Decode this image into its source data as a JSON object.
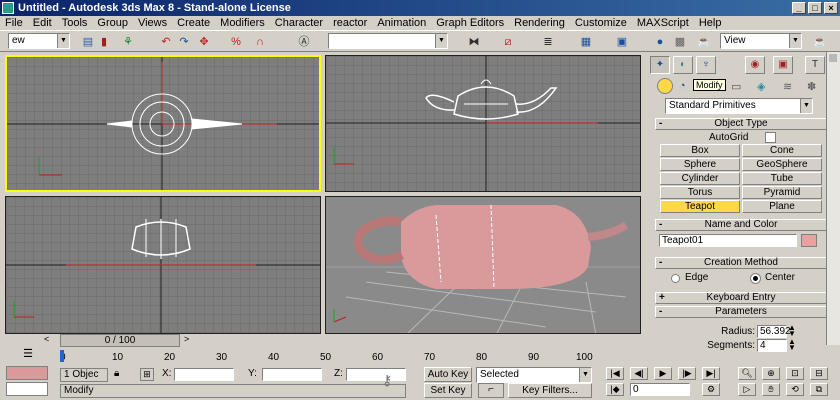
{
  "window": {
    "title": "Untitled  - Autodesk 3ds Max 8  - Stand-alone License",
    "minimize": "_",
    "maximize": "□",
    "close": "×"
  },
  "menu": [
    "File",
    "Edit",
    "Tools",
    "Group",
    "Views",
    "Create",
    "Modifiers",
    "Character",
    "reactor",
    "Animation",
    "Graph Editors",
    "Rendering",
    "Customize",
    "MAXScript",
    "Help"
  ],
  "toolbar": {
    "selection_filter": "ew",
    "named_selection": "",
    "view_dropdown": "View"
  },
  "command_panel": {
    "tooltip": "Modify",
    "category_dropdown": "Standard Primitives",
    "object_type": {
      "title": "Object Type",
      "autogrid_label": "AutoGrid",
      "buttons": [
        "Box",
        "Cone",
        "Sphere",
        "GeoSphere",
        "Cylinder",
        "Tube",
        "Torus",
        "Pyramid",
        "Teapot",
        "Plane"
      ],
      "active": "Teapot"
    },
    "name_color": {
      "title": "Name and Color",
      "name": "Teapot01",
      "color": "#e8a0a0"
    },
    "creation_method": {
      "title": "Creation Method",
      "edge_label": "Edge",
      "center_label": "Center",
      "selected": "Center"
    },
    "keyboard_entry": {
      "title": "Keyboard Entry",
      "toggle": "+"
    },
    "parameters": {
      "title": "Parameters",
      "toggle": "-",
      "radius_label": "Radius:",
      "radius": "56.392",
      "segments_label": "Segments:",
      "segments": "4"
    },
    "rollout_toggle": "-"
  },
  "timeline": {
    "frame_display": "0 / 100",
    "ticks": [
      "0",
      "10",
      "20",
      "30",
      "40",
      "50",
      "60",
      "70",
      "80",
      "90",
      "100"
    ]
  },
  "status": {
    "selection_count": "1 Objec",
    "x_label": "X:",
    "y_label": "Y:",
    "z_label": "Z:",
    "prompt": "Modify",
    "auto_key": "Auto Key",
    "set_key": "Set Key",
    "key_mode": "Selected",
    "key_filters": "Key Filters...",
    "frame": "0"
  },
  "colors": {
    "active_viewport_border": "#ffff00",
    "viewport_bg": "#7e7e7e",
    "teapot_color": "#e8a0a0",
    "title_bar": "#0a246a"
  }
}
